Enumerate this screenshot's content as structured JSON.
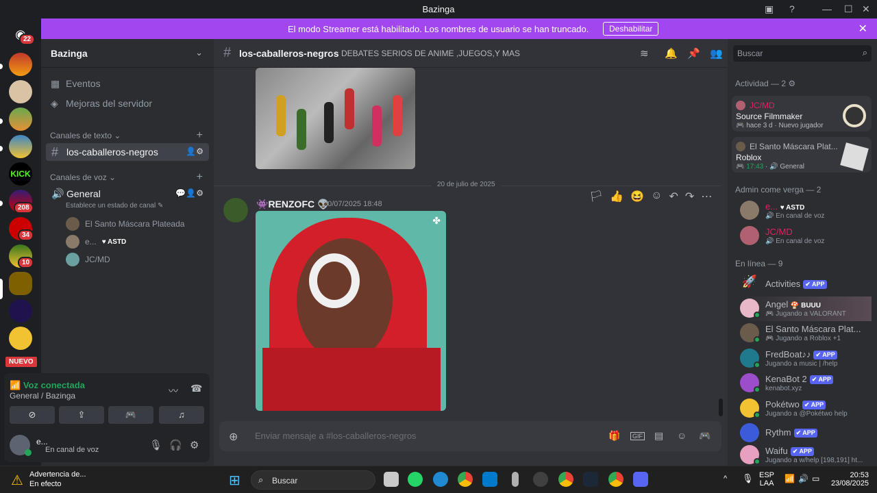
{
  "window": {
    "title": "Bazinga"
  },
  "banner": {
    "text": "El modo Streamer está habilitado. Los nombres de usuario se han truncado.",
    "button": "Deshabilitar"
  },
  "guilds": {
    "home_badge": "22",
    "badges": [
      "208",
      "34",
      "10"
    ],
    "new_label": "NUEVO"
  },
  "sidebar": {
    "server_name": "Bazinga",
    "items": [
      {
        "label": "Eventos",
        "icon": "calendar-icon"
      },
      {
        "label": "Mejoras del servidor",
        "icon": "boost-icon"
      }
    ],
    "text_category": "Canales de texto",
    "text_channel": "los-caballeros-negros",
    "voice_category": "Canales de voz",
    "voice_channel": "General",
    "voice_status": "Establece un estado de canal",
    "voice_users": [
      {
        "name": "El Santo Máscara Plateada"
      },
      {
        "name": "e...",
        "tag": "ASTD"
      },
      {
        "name": "JC/MD"
      }
    ]
  },
  "voice_panel": {
    "status": "Voz conectada",
    "location": "General / Bazinga",
    "user_name": "e...",
    "user_status": "En canal de voz"
  },
  "chat": {
    "channel": "los-caballeros-negros",
    "topic": "DEBATES SERIOS DE ANIME ,JUEGOS,Y MAS",
    "date_divider": "20 de julio de 2025",
    "author": "RENZOFC",
    "timestamp": "20/07/2025 18:48",
    "input_placeholder": "Enviar mensaje a #los-caballeros-negros"
  },
  "members": {
    "search_placeholder": "Buscar",
    "activity_header": "Actividad — 2",
    "activity_cards": [
      {
        "user": "JC/MD",
        "game": "Source Filmmaker",
        "meta": "hace 3 d",
        "meta2": "Nuevo jugador"
      },
      {
        "user": "El Santo Máscara Plat...",
        "game": "Roblox",
        "meta": "17:43",
        "meta2": "General"
      }
    ],
    "role_header": "Admin come verga — 2",
    "role_members": [
      {
        "name": "e...",
        "tag": "ASTD",
        "status": "En canal de voz"
      },
      {
        "name": "JC/MD",
        "status": "En canal de voz"
      }
    ],
    "online_header": "En línea — 9",
    "online_members": [
      {
        "name": "Activities",
        "app": "APP",
        "status": ""
      },
      {
        "name": "Angel",
        "tag": "BUUU",
        "status": "Jugando a VALORANT"
      },
      {
        "name": "El Santo Máscara Plat...",
        "status": "Jugando a Roblox +1"
      },
      {
        "name": "FredBoat♪♪",
        "app": "APP",
        "status": "Jugando a music | /help"
      },
      {
        "name": "KenaBot 2",
        "app": "APP",
        "status": "kenabot.xyz"
      },
      {
        "name": "Pokétwo",
        "app": "APP",
        "status": "Jugando a @Pokétwo help"
      },
      {
        "name": "Rythm",
        "app": "APP",
        "status": ""
      },
      {
        "name": "Waifu",
        "app": "APP",
        "status": "Jugando a w/help [198,191] ht..."
      }
    ]
  },
  "taskbar": {
    "warning_title": "Advertencia de...",
    "warning_sub": "En efecto",
    "search": "Buscar",
    "lang1": "ESP",
    "lang2": "LAA",
    "time": "20:53",
    "date": "23/08/2025"
  },
  "colors": {
    "accent": "#5865f2",
    "streamer_banner": "#a246ef",
    "online": "#23a55a"
  }
}
